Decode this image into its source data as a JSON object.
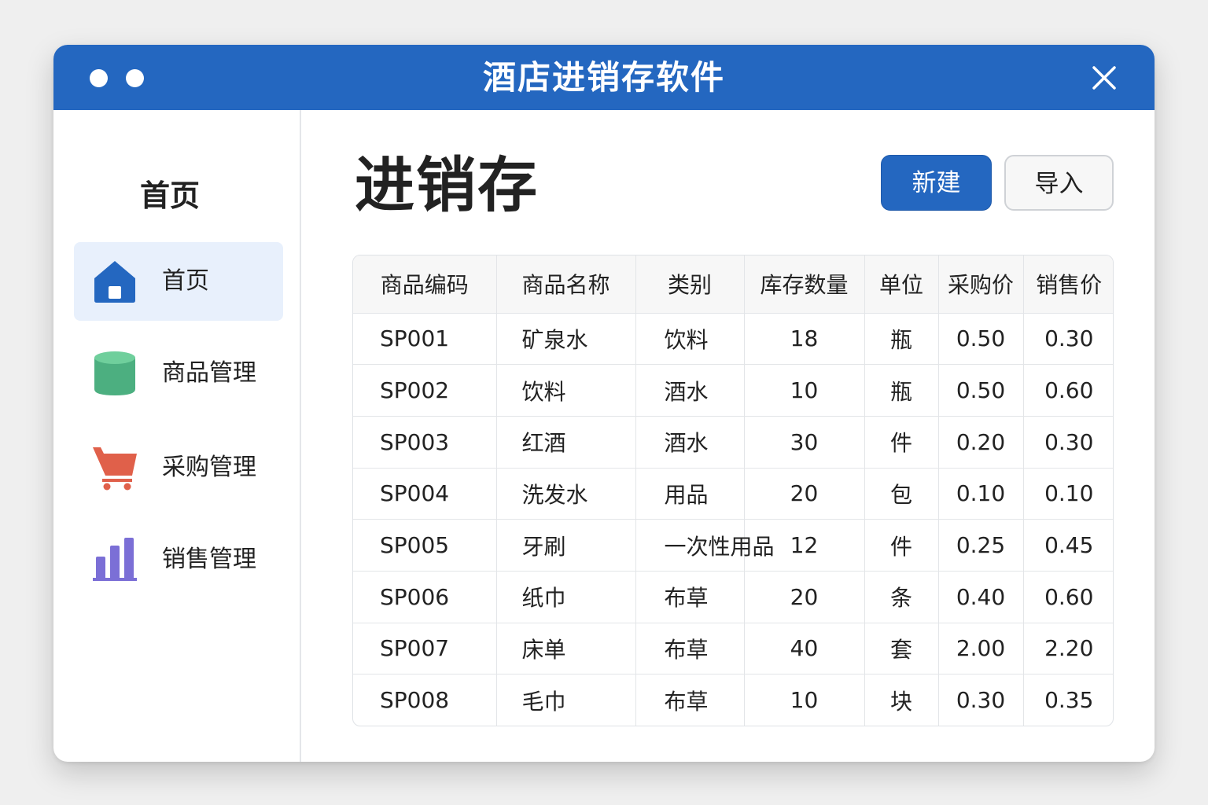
{
  "window": {
    "title": "酒店进销存软件"
  },
  "sidebar": {
    "title": "首页",
    "items": [
      {
        "label": "首页",
        "icon": "home-icon",
        "color": "#2467c0",
        "active": true
      },
      {
        "label": "商品管理",
        "icon": "database-icon",
        "color": "#4caf80",
        "active": false
      },
      {
        "label": "采购管理",
        "icon": "cart-icon",
        "color": "#e0604a",
        "active": false
      },
      {
        "label": "销售管理",
        "icon": "bar-chart-icon",
        "color": "#7b6fd6",
        "active": false
      }
    ]
  },
  "main": {
    "title": "进销存",
    "new_button": "新建",
    "import_button": "导入"
  },
  "table": {
    "columns": [
      "商品编码",
      "商品名称",
      "类别",
      "库存数量",
      "单位",
      "采购价",
      "销售价"
    ],
    "rows": [
      [
        "SP001",
        "矿泉水",
        "饮料",
        "18",
        "瓶",
        "0.50",
        "0.30"
      ],
      [
        "SP002",
        "饮料",
        "酒水",
        "10",
        "瓶",
        "0.50",
        "0.60"
      ],
      [
        "SP003",
        "红酒",
        "酒水",
        "30",
        "件",
        "0.20",
        "0.30"
      ],
      [
        "SP004",
        "洗发水",
        "用品",
        "20",
        "包",
        "0.10",
        "0.10"
      ],
      [
        "SP005",
        "牙刷",
        "一次性用品",
        "12",
        "件",
        "0.25",
        "0.45"
      ],
      [
        "SP006",
        "纸巾",
        "布草",
        "20",
        "条",
        "0.40",
        "0.60"
      ],
      [
        "SP007",
        "床单",
        "布草",
        "40",
        "套",
        "2.00",
        "2.20"
      ],
      [
        "SP008",
        "毛巾",
        "布草",
        "10",
        "块",
        "0.30",
        "0.35"
      ]
    ]
  },
  "colors": {
    "accent": "#2467c0",
    "sidebar_active": "#e8f0fc"
  }
}
